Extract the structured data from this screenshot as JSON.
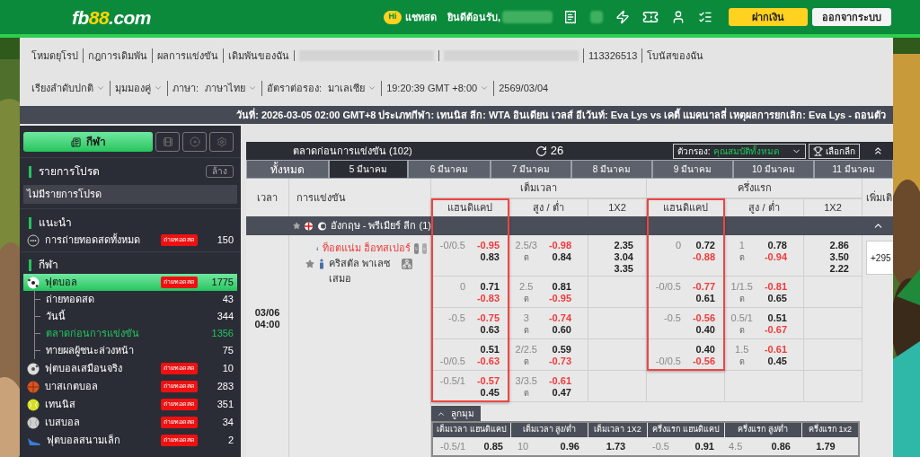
{
  "header": {
    "logo": [
      {
        "text": "fb",
        "accent": false
      },
      {
        "text": "88",
        "accent": true
      },
      {
        "text": ".com",
        "accent": false
      }
    ],
    "chat_badge": "Hi",
    "chat_label": "แชทสด",
    "welcome": "ยินดีต้อนรับ,",
    "buttons": [
      {
        "label": "ฝากเงิน",
        "kind": "primary"
      },
      {
        "label": "ออกจากระบบ",
        "kind": "secondary"
      }
    ]
  },
  "nav": [
    {
      "kind": "link",
      "label": "โหมดยุโรป"
    },
    {
      "kind": "link",
      "label": "กฎการเดิมพัน"
    },
    {
      "kind": "link",
      "label": "ผลการแข่งขัน"
    },
    {
      "kind": "link",
      "label": "เดิมพันของฉัน"
    },
    {
      "kind": "redacted"
    },
    {
      "kind": "redacted"
    },
    {
      "kind": "link",
      "label": "113326513"
    },
    {
      "kind": "link",
      "label": "โบนัสของฉัน"
    }
  ],
  "settings": [
    {
      "label": "เรียงลำดับปกติ",
      "dropdown": true
    },
    {
      "label": "มุมมองคู่",
      "dropdown": true
    },
    {
      "label": "ภาษา:",
      "value": "ภาษาไทย",
      "dropdown": true
    },
    {
      "label": "อัตราต่อรอง:",
      "value": "มาเลเซีย",
      "dropdown": true
    },
    {
      "label": "19:20:39 GMT +8:00",
      "dropdown": true
    },
    {
      "label": "2569/03/04",
      "dropdown": false
    }
  ],
  "announcement": "วันที่: 2026-03-05 02:00 GMT+8 ประเภทกีฬา: เทนนิส ลีก: WTA อินเดียน เวลส์ อีเว้นท์: Eva Lys vs เคตี้ แมคนาลลี่ เหตุผลการยกเลิก: Eva Lys - ถอนตัว",
  "sidebar": {
    "tabs": [
      {
        "kind": "text",
        "label": "กีฬา",
        "selected": true
      },
      {
        "kind": "film",
        "selected": false
      },
      {
        "kind": "disc",
        "selected": false
      },
      {
        "kind": "gear",
        "selected": false
      }
    ],
    "favorites": {
      "title": "รายการโปรด",
      "clear_label": "ล้าง",
      "empty_text": "ไม่มีรายการโปรด"
    },
    "recommended": {
      "title": "แนะนำ",
      "items": [
        {
          "kind": "live_all",
          "label": "การถ่ายทอดสดทั้งหมด",
          "badge": "ถ่ายทอดสด",
          "count": "150",
          "selected": false
        }
      ]
    },
    "sports": {
      "title": "กีฬา",
      "items": [
        {
          "kind": "football",
          "label": "ฟุตบอล",
          "badge": "ถ่ายทอดสด",
          "count": "1775",
          "selected": true,
          "children": [
            {
              "label": "ถ่ายทอดสด",
              "count": "43",
              "selected": false
            },
            {
              "label": "วันนี้",
              "count": "344",
              "selected": false
            },
            {
              "label": "ตลาดก่อนการแข่งขัน",
              "count": "1356",
              "selected": true
            },
            {
              "label": "ทายผลผู้ชนะล่วงหน้า",
              "count": "75",
              "selected": false
            }
          ]
        },
        {
          "kind": "virtual_football",
          "label": "ฟุตบอลเสมือนจริง",
          "badge": "ถ่ายทอดสด",
          "count": "10",
          "selected": false
        },
        {
          "kind": "basketball",
          "label": "บาสเกตบอล",
          "badge": "ถ่ายทอดสด",
          "count": "283",
          "selected": false
        },
        {
          "kind": "tennis",
          "label": "เทนนิส",
          "badge": "ถ่ายทอดสด",
          "count": "351",
          "selected": false
        },
        {
          "kind": "baseball",
          "label": "เบสบอล",
          "badge": "ถ่ายทอดสด",
          "count": "34",
          "selected": false
        },
        {
          "kind": "futsal",
          "label": "ฟุตบอลสนามเล็ก",
          "badge": "ถ่ายทอดสด",
          "count": "2",
          "selected": false
        }
      ]
    }
  },
  "main": {
    "title": "ตลาดก่อนการแข่งขัน (102)",
    "refresh_count": "26",
    "filter": {
      "label": "ตัวกรอง:",
      "value": "คุณสมบัติทั้งหมด"
    },
    "league_button": "เลือกลีก",
    "date_tabs": [
      {
        "label": "ทั้งหมด",
        "selected": false
      },
      {
        "label": "5 มีนาคม",
        "selected": true
      },
      {
        "label": "6 มีนาคม",
        "selected": false
      },
      {
        "label": "7 มีนาคม",
        "selected": false
      },
      {
        "label": "8 มีนาคม",
        "selected": false
      },
      {
        "label": "9 มีนาคม",
        "selected": false
      },
      {
        "label": "10 มีนาคม",
        "selected": false
      },
      {
        "label": "11 มีนาคม",
        "selected": false
      }
    ],
    "table": {
      "time_header": "เวลา",
      "match_header": "การแข่งขัน",
      "more_header": "เพิ่มเติ",
      "groups": [
        {
          "label": "เต็มเวลา",
          "columns": [
            {
              "label": "แฮนดิแคป",
              "highlighted": true
            },
            {
              "label": "สูง / ต่ำ",
              "highlighted": false
            },
            {
              "label": "1X2",
              "highlighted": false
            }
          ]
        },
        {
          "label": "ครึ่งแรก",
          "columns": [
            {
              "label": "แฮนดิแคป",
              "highlighted": true
            },
            {
              "label": "สูง / ต่ำ",
              "highlighted": false
            },
            {
              "label": "1X2",
              "highlighted": false
            }
          ]
        }
      ],
      "league": {
        "name": "อังกฤษ - พรีเมียร์ ลีก (1)",
        "expanded": true
      },
      "match": {
        "date": "03/06",
        "time": "04:00",
        "home": "ท็อตแน่ม ฮ็อทสเปอร์",
        "away": "คริสตัล พาเลซ",
        "draw": "เสมอ",
        "home_favored": true,
        "more": "+295",
        "markets": [
          {
            "ft_hdp": {
              "line": "-0/0.5",
              "line_below": false,
              "odds": [
                {
                  "v": "-0.95",
                  "neg": true
                },
                {
                  "v": "0.83",
                  "neg": false
                }
              ]
            },
            "ft_ou": {
              "line": "2.5/3",
              "under": "ต",
              "odds": [
                {
                  "v": "-0.98",
                  "neg": true
                },
                {
                  "v": "0.84",
                  "neg": false
                }
              ]
            },
            "ft_1x2": [
              "2.35",
              "3.04",
              "3.35"
            ],
            "ht_hdp": {
              "line": "0",
              "line_below": false,
              "odds": [
                {
                  "v": "0.72",
                  "neg": false
                },
                {
                  "v": "-0.88",
                  "neg": true
                }
              ]
            },
            "ht_ou": {
              "line": "1",
              "under": "ต",
              "odds": [
                {
                  "v": "0.78",
                  "neg": false
                },
                {
                  "v": "-0.94",
                  "neg": true
                }
              ]
            },
            "ht_1x2": [
              "2.86",
              "3.50",
              "2.22"
            ]
          },
          {
            "ft_hdp": {
              "line": "0",
              "line_below": false,
              "odds": [
                {
                  "v": "0.71",
                  "neg": false
                },
                {
                  "v": "-0.83",
                  "neg": true
                }
              ]
            },
            "ft_ou": {
              "line": "2.5",
              "under": "ต",
              "odds": [
                {
                  "v": "0.81",
                  "neg": false
                },
                {
                  "v": "-0.95",
                  "neg": true
                }
              ]
            },
            "ht_hdp": {
              "line": "-0/0.5",
              "line_below": false,
              "odds": [
                {
                  "v": "-0.77",
                  "neg": true
                },
                {
                  "v": "0.61",
                  "neg": false
                }
              ]
            },
            "ht_ou": {
              "line": "1/1.5",
              "under": "ต",
              "odds": [
                {
                  "v": "-0.81",
                  "neg": true
                },
                {
                  "v": "0.65",
                  "neg": false
                }
              ]
            }
          },
          {
            "ft_hdp": {
              "line": "-0.5",
              "line_below": false,
              "odds": [
                {
                  "v": "-0.75",
                  "neg": true
                },
                {
                  "v": "0.63",
                  "neg": false
                }
              ]
            },
            "ft_ou": {
              "line": "3",
              "under": "ต",
              "odds": [
                {
                  "v": "-0.74",
                  "neg": true
                },
                {
                  "v": "0.60",
                  "neg": false
                }
              ]
            },
            "ht_hdp": {
              "line": "-0.5",
              "line_below": false,
              "odds": [
                {
                  "v": "-0.56",
                  "neg": true
                },
                {
                  "v": "0.40",
                  "neg": false
                }
              ]
            },
            "ht_ou": {
              "line": "0.5/1",
              "under": "ต",
              "odds": [
                {
                  "v": "0.51",
                  "neg": false
                },
                {
                  "v": "-0.67",
                  "neg": true
                }
              ]
            }
          },
          {
            "ft_hdp": {
              "line": "-0/0.5",
              "line_below": true,
              "odds": [
                {
                  "v": "0.51",
                  "neg": false
                },
                {
                  "v": "-0.63",
                  "neg": true
                }
              ]
            },
            "ft_ou": {
              "line": "2/2.5",
              "under": "ต",
              "odds": [
                {
                  "v": "0.59",
                  "neg": false
                },
                {
                  "v": "-0.73",
                  "neg": true
                }
              ]
            },
            "ht_hdp": {
              "line": "-0/0.5",
              "line_below": true,
              "odds": [
                {
                  "v": "0.40",
                  "neg": false
                },
                {
                  "v": "-0.56",
                  "neg": true
                }
              ]
            },
            "ht_ou": {
              "line": "1.5",
              "under": "ต",
              "odds": [
                {
                  "v": "-0.61",
                  "neg": true
                },
                {
                  "v": "0.45",
                  "neg": false
                }
              ]
            }
          },
          {
            "ft_hdp": {
              "line": "-0.5/1",
              "line_below": false,
              "odds": [
                {
                  "v": "-0.57",
                  "neg": true
                },
                {
                  "v": "0.45",
                  "neg": false
                }
              ]
            },
            "ft_ou": {
              "line": "3/3.5",
              "under": "ต",
              "odds": [
                {
                  "v": "-0.61",
                  "neg": true
                },
                {
                  "v": "0.47",
                  "neg": false
                }
              ]
            }
          }
        ]
      }
    },
    "corners": {
      "label": "ลูกมุม",
      "expanded": true,
      "headers": [
        "เต็มเวลา แฮนดิแคป",
        "เต็มเวลา สูง/ต่ำ",
        "เต็มเวลา 1X2",
        "ครึ่งแรก แฮนดิแคป",
        "ครึ่งแรก สูง/ต่ำ",
        "ครึ่งแรก 1x2"
      ],
      "row": [
        {
          "line": "-0.5/1",
          "odds": "0.85"
        },
        {
          "line": "10",
          "odds": "0.96"
        },
        {
          "odds": "1.73"
        },
        {
          "line": "-0.5",
          "odds": "0.91"
        },
        {
          "line": "4.5",
          "odds": "0.86"
        },
        {
          "odds": "1.79"
        }
      ]
    }
  }
}
